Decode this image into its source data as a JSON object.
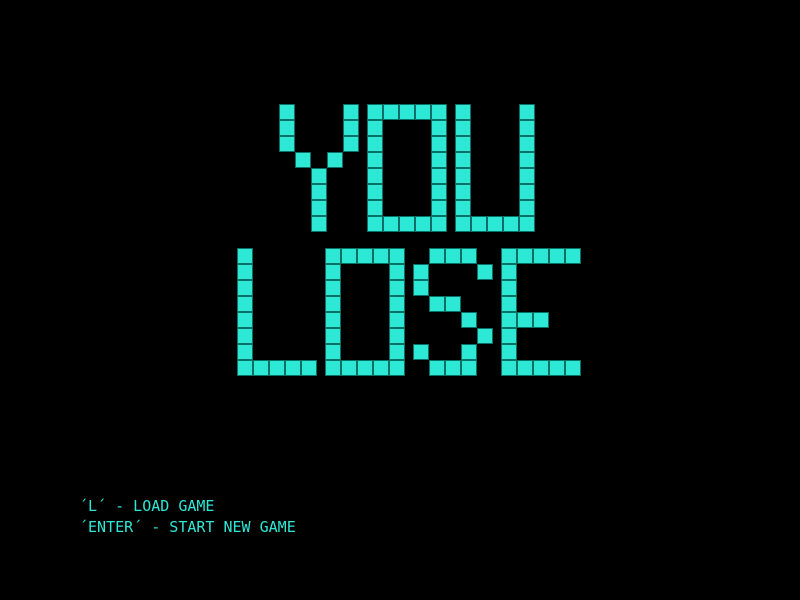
{
  "screen": {
    "background_color": "#000000",
    "accent_color": "#2ee8d6",
    "block_border_color": "#0b6f66"
  },
  "title": {
    "line1": "YOU",
    "line2": "LOSE"
  },
  "menu": {
    "load_game": "´L´ - LOAD GAME",
    "new_game": "´ENTER´ - START NEW GAME"
  }
}
